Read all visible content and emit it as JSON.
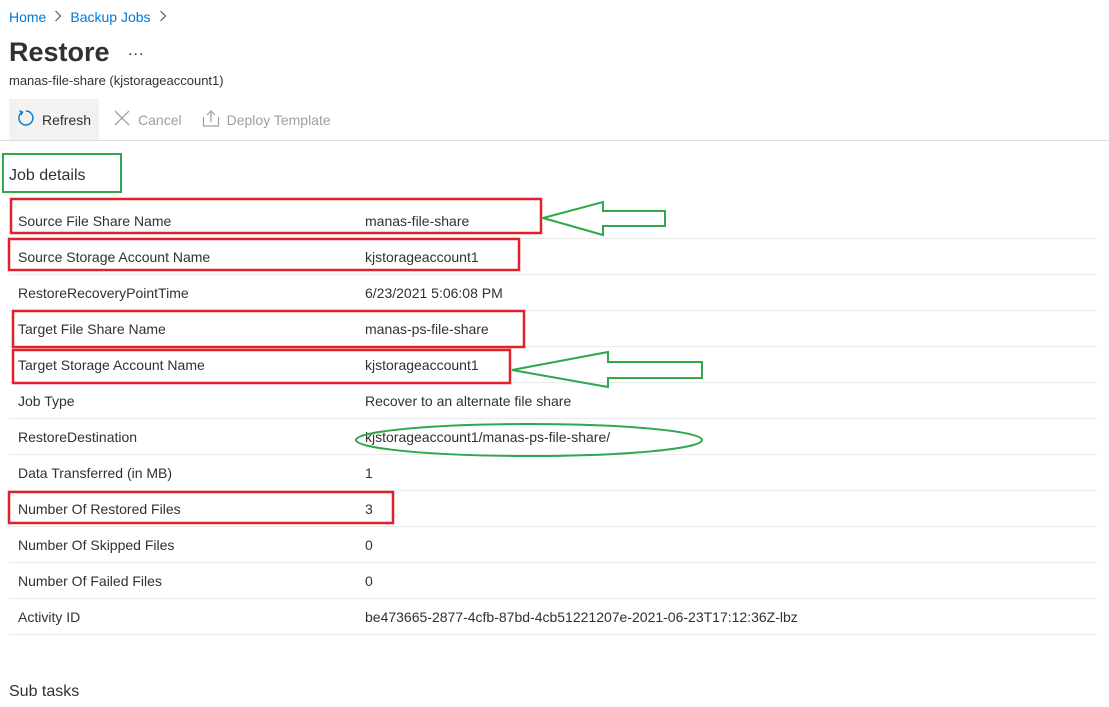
{
  "breadcrumb": {
    "home": "Home",
    "backup_jobs": "Backup Jobs",
    "sep": ">"
  },
  "page": {
    "title": "Restore",
    "more": "...",
    "subtitle": "manas-file-share (kjstorageaccount1)"
  },
  "toolbar": {
    "refresh": "Refresh",
    "cancel": "Cancel",
    "deploy_template": "Deploy Template"
  },
  "job_details": {
    "title": "Job details",
    "rows": [
      {
        "label": "Source File Share Name",
        "value": "manas-file-share"
      },
      {
        "label": "Source Storage Account Name",
        "value": "kjstorageaccount1"
      },
      {
        "label": "RestoreRecoveryPointTime",
        "value": "6/23/2021 5:06:08 PM"
      },
      {
        "label": "Target File Share Name",
        "value": "manas-ps-file-share"
      },
      {
        "label": "Target Storage Account Name",
        "value": "kjstorageaccount1"
      },
      {
        "label": "Job Type",
        "value": "Recover to an alternate file share"
      },
      {
        "label": "RestoreDestination",
        "value": "kjstorageaccount1/manas-ps-file-share/"
      },
      {
        "label": "Data Transferred (in MB)",
        "value": "1"
      },
      {
        "label": "Number Of Restored Files",
        "value": "3"
      },
      {
        "label": "Number Of Skipped Files",
        "value": "0"
      },
      {
        "label": "Number Of Failed Files",
        "value": "0"
      },
      {
        "label": "Activity ID",
        "value": "be473665-2877-4cfb-87bd-4cb51221207e-2021-06-23T17:12:36Z-lbz"
      }
    ]
  },
  "sub_tasks": {
    "title": "Sub tasks"
  },
  "annotation_colors": {
    "red": "#e0202a",
    "green": "#2ea84a"
  }
}
